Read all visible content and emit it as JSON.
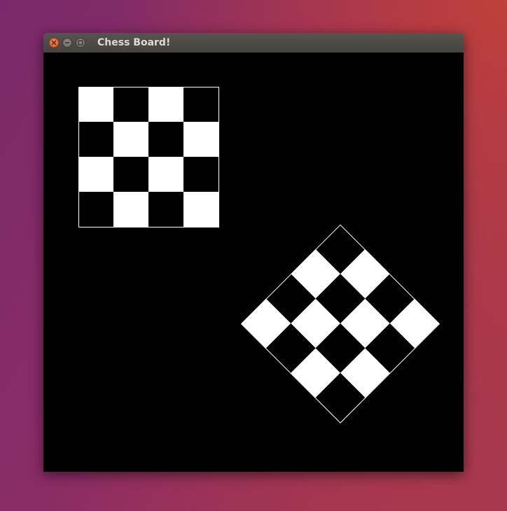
{
  "window": {
    "title": "Chess Board!"
  },
  "icons": {
    "close": "close-icon",
    "minimize": "minimize-icon",
    "maximize": "maximize-icon"
  },
  "colors": {
    "canvas_background": "#000000",
    "light_square": "#ffffff",
    "dark_square": "#000000",
    "board_border": "#ffffff",
    "close_button": "#e05a2b",
    "titlebar": "#4a4844"
  },
  "boards": [
    {
      "name": "axis-aligned-board",
      "rows": 4,
      "cols": 4,
      "rotation_deg": 0,
      "top_left_square": "light"
    },
    {
      "name": "rotated-board",
      "rows": 4,
      "cols": 4,
      "rotation_deg": 45,
      "top_left_square": "dark"
    }
  ]
}
